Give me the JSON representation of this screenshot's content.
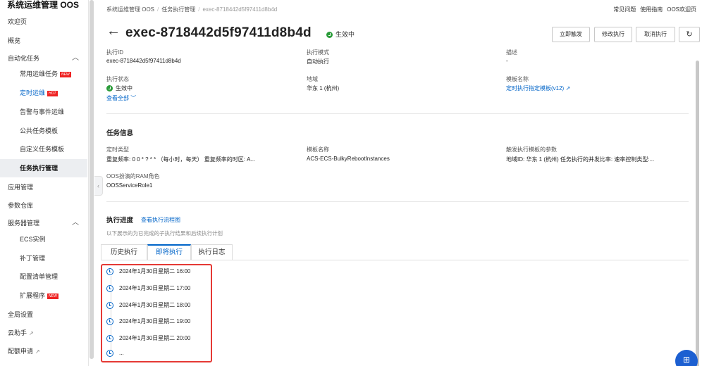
{
  "sidebar": {
    "title": "系统运维管理 OOS",
    "items": [
      {
        "label": "欢迎页"
      },
      {
        "label": "概览"
      },
      {
        "label": "自动化任务"
      },
      {
        "label": "常用运维任务",
        "badge": "NEW"
      },
      {
        "label": "定时运维",
        "badge": "HOT"
      },
      {
        "label": "告警与事件运维"
      },
      {
        "label": "公共任务模板"
      },
      {
        "label": "自定义任务模板"
      },
      {
        "label": "任务执行管理"
      },
      {
        "label": "应用管理"
      },
      {
        "label": "参数仓库"
      },
      {
        "label": "服务器管理"
      },
      {
        "label": "ECS实例"
      },
      {
        "label": "补丁管理"
      },
      {
        "label": "配置清单管理"
      },
      {
        "label": "扩展程序",
        "badge": "NEW"
      },
      {
        "label": "全局设置"
      },
      {
        "label": "云助手"
      },
      {
        "label": "配额申请"
      }
    ]
  },
  "breadcrumb": {
    "items": [
      "系统运维管理 OOS",
      "任务执行管理",
      "exec-8718442d5f97411d8b4d"
    ]
  },
  "toplinks": {
    "faq": "常见问题",
    "guide": "使用指南",
    "welcome": "OOS欢迎页"
  },
  "header": {
    "title": "exec-8718442d5f97411d8b4d",
    "status": "生效中",
    "buttons": {
      "trigger": "立即触发",
      "modify": "修改执行",
      "cancel": "取消执行"
    }
  },
  "info": {
    "exec_id_label": "执行ID",
    "exec_id": "exec-8718442d5f97411d8b4d",
    "mode_label": "执行模式",
    "mode": "自动执行",
    "desc_label": "描述",
    "desc": "-",
    "state_label": "执行状态",
    "state": "生效中",
    "view_all": "查看全部",
    "region_label": "地域",
    "region": "华东 1 (杭州)",
    "template_label": "模板名称",
    "template": "定时执行指定模板(v12)"
  },
  "task": {
    "section_title": "任务信息",
    "timer_type_label": "定时类型",
    "timer_type": "重复频率: 0 0 * ? * * （每小时，每天） 重复频率的时区: A...",
    "template_name_label": "模板名称",
    "template_name": "ACS-ECS-BulkyRebootInstances",
    "params_label": "触发执行模板的参数",
    "params": "地域ID: 华东 1 (杭州) 任务执行的并发比率: 速率控制类型:...",
    "ram_label": "OOS扮演的RAM角色",
    "ram": "OOSServiceRole1"
  },
  "progress": {
    "section_title": "执行进度",
    "flow_link": "查看执行流程图",
    "hint": "以下展示的为已完成的子执行结果和后续执行计划",
    "tabs": [
      "历史执行",
      "即将执行",
      "执行日志"
    ],
    "schedule": [
      "2024年1月30日星期二 16:00",
      "2024年1月30日星期二 17:00",
      "2024年1月30日星期二 18:00",
      "2024年1月30日星期二 19:00",
      "2024年1月30日星期二 20:00",
      "..."
    ]
  },
  "colors": {
    "accent": "#0064c8",
    "success": "#2b9c3a",
    "highlight": "#e53935"
  }
}
